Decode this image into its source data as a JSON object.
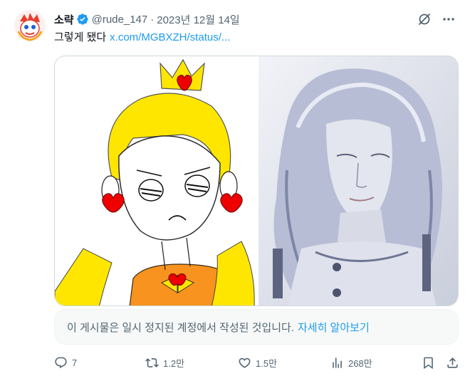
{
  "author": {
    "display_name": "소략",
    "handle": "@rude_147",
    "separator": "·",
    "date": "2023년 12월 14일"
  },
  "tweet": {
    "text": "그렇게 됐다",
    "link": "x.com/MGBXZH/status/..."
  },
  "notice": {
    "text": "이 게시물은 일시 정지된 계정에서 작성된 것입니다.",
    "link_text": "자세히 알아보기"
  },
  "actions": {
    "replies": "7",
    "reposts": "1.2만",
    "likes": "1.5만",
    "views": "268만"
  },
  "colors": {
    "accent": "#1d9bf0",
    "muted": "#536471",
    "text": "#0f1419"
  }
}
